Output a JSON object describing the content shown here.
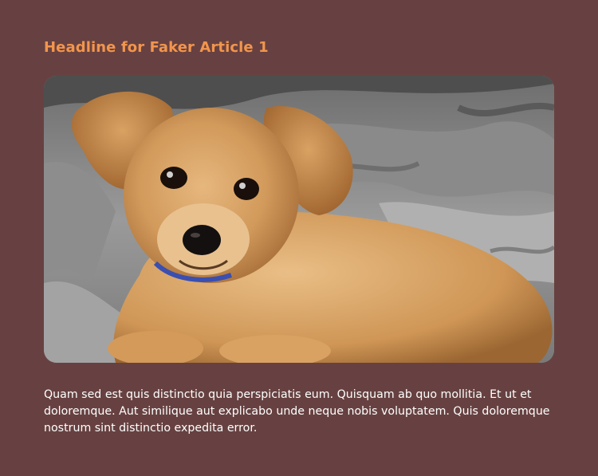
{
  "article": {
    "headline": "Headline for Faker Article 1",
    "image_icon": "puppy-photo",
    "body": "Quam sed est quis distinctio quia perspiciatis eum. Quisquam ab quo mollitia. Et ut et doloremque. Aut similique aut explicabo unde neque nobis voluptatem. Quis doloremque nostrum sint distinctio expedita error."
  },
  "colors": {
    "background": "#674141",
    "headline": "#f2954d",
    "body_text": "#ffffff"
  }
}
